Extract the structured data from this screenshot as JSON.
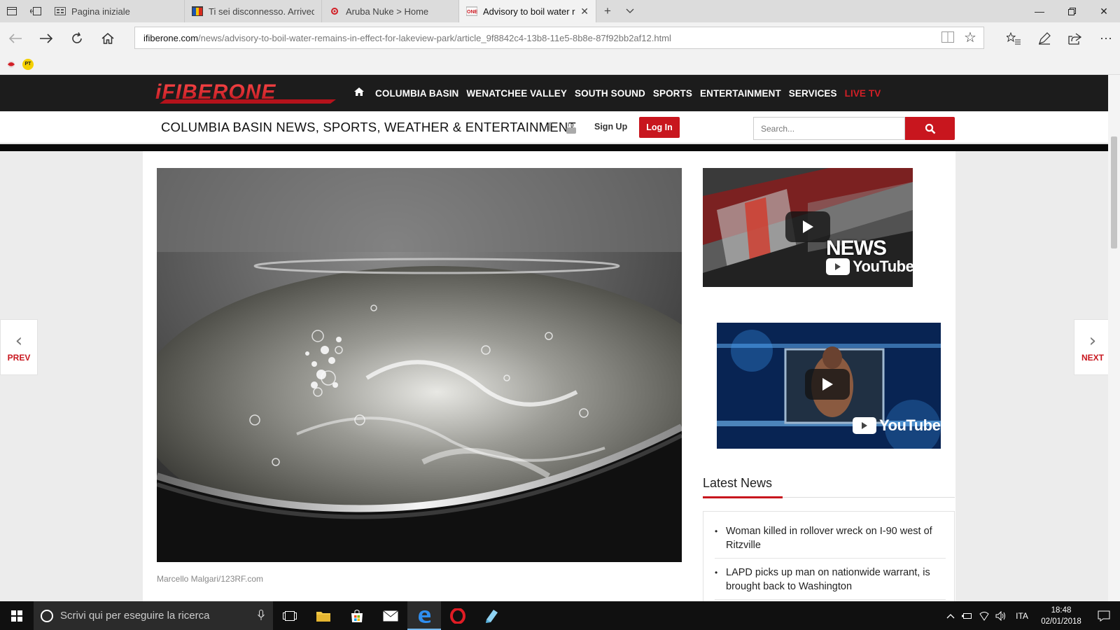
{
  "browser": {
    "tabs": [
      {
        "label": "Pagina iniziale",
        "active": false
      },
      {
        "label": "Ti sei disconnesso. Arrivede",
        "active": false
      },
      {
        "label": "Aruba Nuke > Home",
        "active": false
      },
      {
        "label": "Advisory to boil water r",
        "active": true
      }
    ],
    "url_domain": "ifiberone.com",
    "url_path": "/news/advisory-to-boil-water-remains-in-effect-for-lakeview-park/article_9f8842c4-13b8-11e5-8b8e-87f92bb2af12.html",
    "favorites": [
      {
        "icon": "red-bird-icon"
      },
      {
        "icon": "pt-icon",
        "text": "PT"
      }
    ]
  },
  "site": {
    "nav": [
      {
        "label": "COLUMBIA BASIN"
      },
      {
        "label": "WENATCHEE VALLEY"
      },
      {
        "label": "SOUTH SOUND"
      },
      {
        "label": "SPORTS"
      },
      {
        "label": "ENTERTAINMENT"
      },
      {
        "label": "SERVICES"
      },
      {
        "label": "LIVE TV"
      }
    ],
    "tagline": "COLUMBIA BASIN NEWS, SPORTS, WEATHER & ENTERTAINMENT",
    "signup": "Sign Up",
    "login": "Log In",
    "search_placeholder": "Search...",
    "brand_color": "#c8161e"
  },
  "article": {
    "image_credit": "Marcello Malgari/123RF.com"
  },
  "sidebar": {
    "video1": {
      "text": "NEWS",
      "platform": "YouTube"
    },
    "video2": {
      "platform": "YouTube"
    },
    "latest_title": "Latest News",
    "latest": [
      "Woman killed in rollover wreck on I-90 west of Ritzville",
      "LAPD picks up man on nationwide warrant, is brought back to Washington"
    ]
  },
  "pager": {
    "prev": "PREV",
    "next": "NEXT"
  },
  "taskbar": {
    "search_placeholder": "Scrivi qui per eseguire la ricerca",
    "language": "ITA",
    "time": "18:48",
    "date": "02/01/2018"
  }
}
